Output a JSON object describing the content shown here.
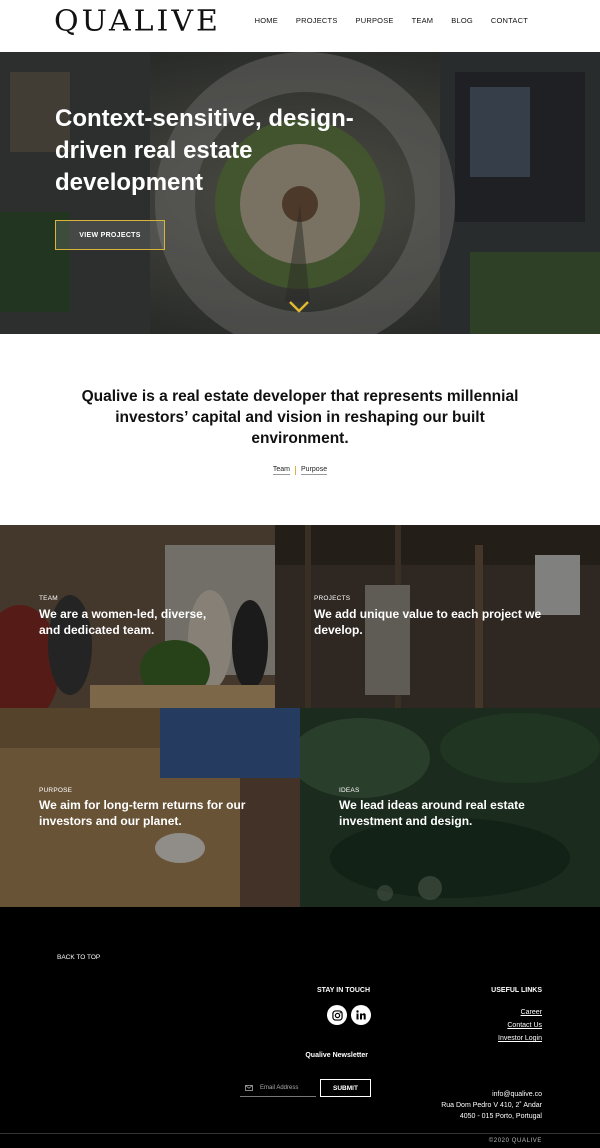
{
  "header": {
    "logo": "QUALIVE",
    "nav": [
      "HOME",
      "PROJECTS",
      "PURPOSE",
      "TEAM",
      "BLOG",
      "CONTACT"
    ]
  },
  "hero": {
    "title": "Context-sensitive, design-driven real estate development",
    "button": "VIEW PROJECTS",
    "scroll_icon": "chevron-down-icon"
  },
  "intro": {
    "text": "Qualive is a real estate developer that represents millennial investors’ capital and vision in reshaping our built environment.",
    "links": [
      "Team",
      "Purpose"
    ]
  },
  "tiles": [
    {
      "kicker": "TEAM",
      "headline": "We are a women-led, diverse, and dedicated team."
    },
    {
      "kicker": "PROJECTS",
      "headline": "We add unique value to each project we develop."
    },
    {
      "kicker": "PURPOSE",
      "headline": "We aim for long-term returns for our investors and our planet."
    },
    {
      "kicker": "IDEAS",
      "headline": "We lead ideas around real estate investment and design."
    }
  ],
  "footer": {
    "back_to_top": "BACK TO TOP",
    "stay_in_touch": "STAY IN TOUCH",
    "social_icons": [
      "instagram-icon",
      "linkedin-icon"
    ],
    "newsletter_label": "Qualive Newsletter",
    "email_placeholder": "Email Address",
    "submit": "SUBMIT",
    "useful_links_heading": "USEFUL LINKS",
    "useful_links": [
      "Career",
      "Contact Us",
      "Investor Login"
    ],
    "email": "info@qualive.co",
    "address_line1": "Rua Dom Pedro V 410, 2˚ Andar",
    "address_line2": "4050 - 015 Porto, Portugal",
    "copyright": "©2020 QUALIVE"
  },
  "colors": {
    "accent": "#d8b43a",
    "footer_bg": "#000000"
  }
}
